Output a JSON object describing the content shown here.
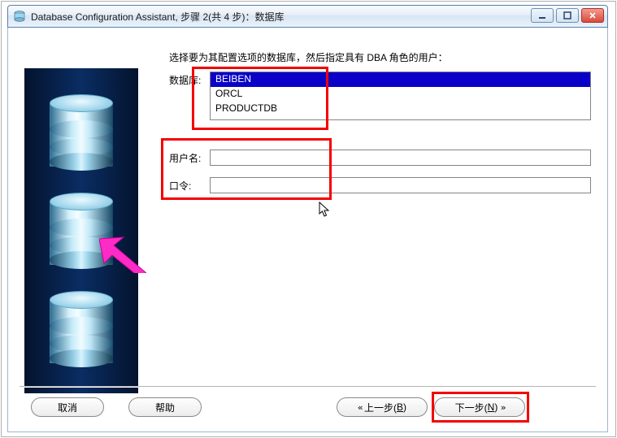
{
  "window": {
    "title": "Database Configuration Assistant, 步骤 2(共 4 步)：数据库"
  },
  "instruction": "选择要为其配置选项的数据库，然后指定具有 DBA 角色的用户：",
  "labels": {
    "database": "数据库:",
    "username": "用户名:",
    "password": "口令:"
  },
  "db_options": {
    "selected": "BEIBEN",
    "opt1": "ORCL",
    "opt2": "PRODUCTDB"
  },
  "form": {
    "username_value": "",
    "password_value": ""
  },
  "buttons": {
    "cancel": "取消",
    "help": "帮助",
    "back_pre": "上一步(",
    "back_key": "B",
    "back_post": ")",
    "next_pre": "下一步(",
    "next_key": "N",
    "next_post": ")"
  }
}
